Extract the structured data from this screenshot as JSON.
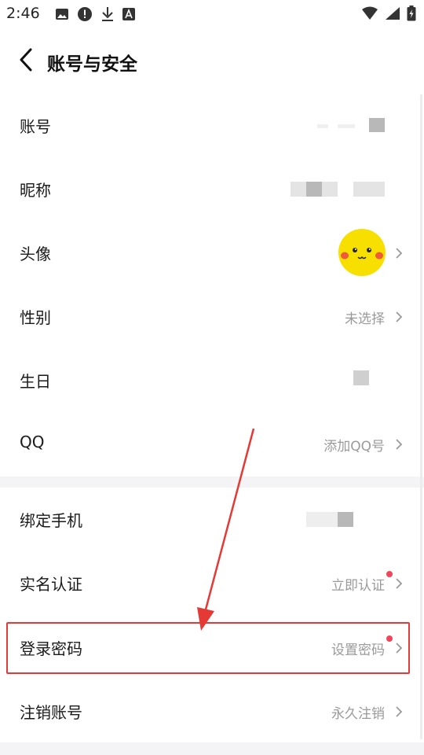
{
  "status_bar": {
    "time": "2:46",
    "icons_left": [
      "image-icon",
      "alert-icon",
      "download-icon",
      "font-icon"
    ],
    "icons_right": [
      "wifi-icon",
      "signal-icon",
      "battery-icon"
    ]
  },
  "header": {
    "title": "账号与安全"
  },
  "rows": [
    {
      "label": "账号",
      "value": ""
    },
    {
      "label": "昵称",
      "value": ""
    },
    {
      "label": "头像",
      "value": ""
    },
    {
      "label": "性别",
      "value": "未选择"
    },
    {
      "label": "生日",
      "value": ""
    },
    {
      "label": "QQ",
      "value": "添加QQ号"
    },
    {
      "label": "绑定手机",
      "value": ""
    },
    {
      "label": "实名认证",
      "value": "立即认证"
    },
    {
      "label": "登录密码",
      "value": "设置密码"
    },
    {
      "label": "注销账号",
      "value": "永久注销"
    }
  ],
  "colors": {
    "annotation": "#e53935",
    "red_dot": "#f0455a",
    "value_text": "#9a9a9a",
    "avatar": "#f7e000"
  }
}
